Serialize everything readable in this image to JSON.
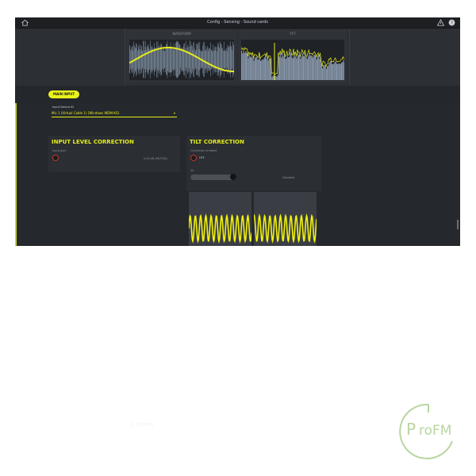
{
  "window": {
    "title": "Config - Sensing - Sound cards"
  },
  "scopes": [
    {
      "label": "WAVEFORM"
    },
    {
      "label": "FFT"
    }
  ],
  "main_tab": {
    "label": "MAIN INPUT"
  },
  "input_device": {
    "label": "Input Device ID",
    "value": "Mic 1 (Virtual Cable 1) [Windows WDM-KS]"
  },
  "input_level": {
    "title": "INPUT LEVEL CORRECTION",
    "gain_label": "Input gain",
    "gain_value": "0.00 dB (MUTED)"
  },
  "tilt": {
    "title": "TILT CORRECTION",
    "enabled_label": "Correction enabled",
    "toggle_state": "OFF",
    "slider_label": "Dc",
    "slider_readout": "Disabled"
  },
  "footer_faint_text": "1 Stereo",
  "logo": {
    "text": "roFM",
    "letter": "P"
  },
  "colors": {
    "accent": "#e4ec1b",
    "app_bg": "#2a2d32",
    "titlebar": "#1d1f23",
    "scope_blue": "#9fb2c8",
    "logo_green": "#b8d6a0"
  },
  "icons": [
    "home-icon",
    "warning-icon",
    "help-icon",
    "chevron-down-icon"
  ]
}
